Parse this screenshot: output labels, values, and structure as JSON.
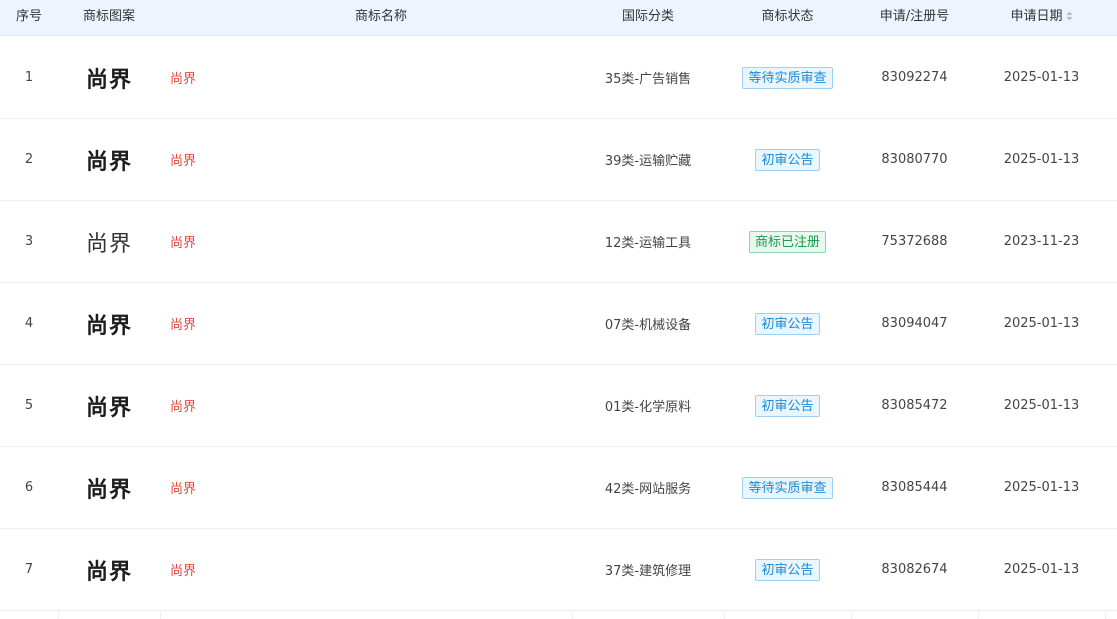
{
  "header": {
    "index": "序号",
    "logo": "商标图案",
    "name": "商标名称",
    "class": "国际分类",
    "status": "商标状态",
    "reg_no": "申请/注册号",
    "date": "申请日期",
    "date_sort_icon": "sort-icon"
  },
  "rows": [
    {
      "index": "1",
      "logo": "尚界",
      "name": "尚界",
      "class": "35类-广告销售",
      "status": "等待实质审查",
      "status_color": "blue",
      "reg_no": "83092274",
      "date": "2025-01-13"
    },
    {
      "index": "2",
      "logo": "尚界",
      "name": "尚界",
      "class": "39类-运输贮藏",
      "status": "初审公告",
      "status_color": "blue",
      "reg_no": "83080770",
      "date": "2025-01-13"
    },
    {
      "index": "3",
      "logo": "尚界",
      "name": "尚界",
      "class": "12类-运输工具",
      "status": "商标已注册",
      "status_color": "green",
      "reg_no": "75372688",
      "date": "2023-11-23"
    },
    {
      "index": "4",
      "logo": "尚界",
      "name": "尚界",
      "class": "07类-机械设备",
      "status": "初审公告",
      "status_color": "blue",
      "reg_no": "83094047",
      "date": "2025-01-13"
    },
    {
      "index": "5",
      "logo": "尚界",
      "name": "尚界",
      "class": "01类-化学原料",
      "status": "初审公告",
      "status_color": "blue",
      "reg_no": "83085472",
      "date": "2025-01-13"
    },
    {
      "index": "6",
      "logo": "尚界",
      "name": "尚界",
      "class": "42类-网站服务",
      "status": "等待实质审查",
      "status_color": "blue",
      "reg_no": "83085444",
      "date": "2025-01-13"
    },
    {
      "index": "7",
      "logo": "尚界",
      "name": "尚界",
      "class": "37类-建筑修理",
      "status": "初审公告",
      "status_color": "blue",
      "reg_no": "83082674",
      "date": "2025-01-13"
    }
  ],
  "colors": {
    "header_bg": "#edf4fd",
    "name_red": "#e8453c",
    "badge_blue": "#1a8ad8",
    "badge_green": "#1a9a4a"
  }
}
